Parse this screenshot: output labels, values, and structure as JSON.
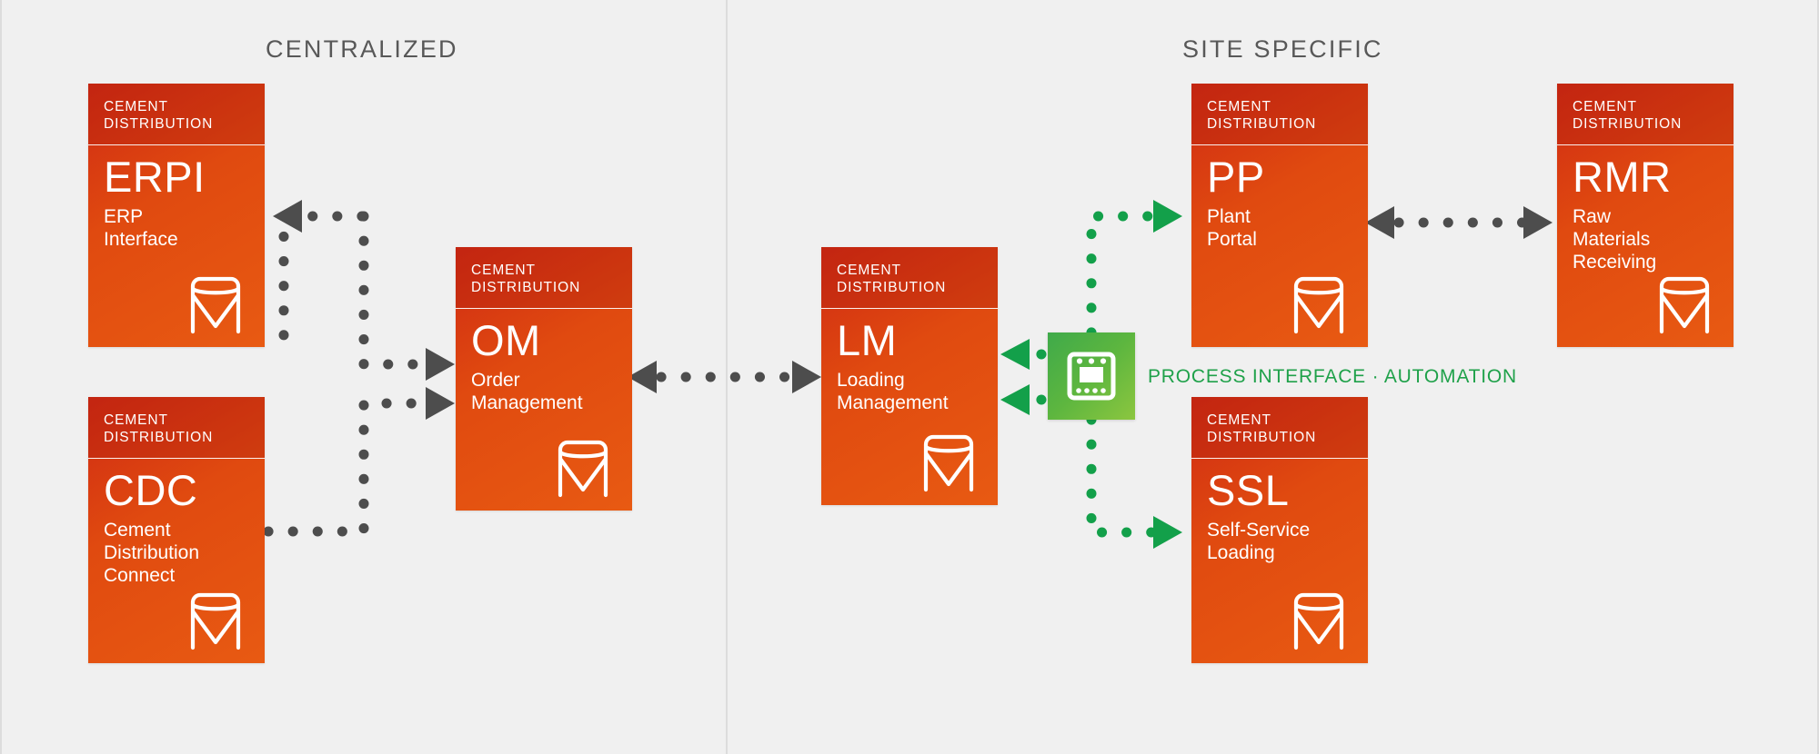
{
  "zones": {
    "left": {
      "title": "CENTRALIZED"
    },
    "right": {
      "title": "SITE SPECIFIC"
    }
  },
  "brand": {
    "head_line1": "CEMENT",
    "head_line2": "DISTRIBUTION",
    "logo_icon": "cement-silo-m-logo"
  },
  "colors": {
    "card_red_dark": "#cf2a13",
    "card_red_light": "#e85a12",
    "green_accent": "#1fa14a",
    "green_box_start": "#3faa4a",
    "green_box_end": "#8cc63f",
    "arrow_grey": "#4d4d4d",
    "background": "#f0f0f0",
    "divider": "#dcdcdc"
  },
  "cards": [
    {
      "id": "erpi",
      "abbr": "ERPI",
      "name": "ERP\nInterface",
      "head_line1": "CEMENT",
      "head_line2": "DISTRIBUTION",
      "zone": "CENTRALIZED"
    },
    {
      "id": "cdc",
      "abbr": "CDC",
      "name": "Cement\nDistribution\nConnect",
      "head_line1": "CEMENT",
      "head_line2": "DISTRIBUTION",
      "zone": "CENTRALIZED"
    },
    {
      "id": "om",
      "abbr": "OM",
      "name": "Order\nManagement",
      "head_line1": "CEMENT",
      "head_line2": "DISTRIBUTION",
      "zone": "CENTRALIZED"
    },
    {
      "id": "lm",
      "abbr": "LM",
      "name": "Loading\nManagement",
      "head_line1": "CEMENT",
      "head_line2": "DISTRIBUTION",
      "zone": "SITE SPECIFIC"
    },
    {
      "id": "pp",
      "abbr": "PP",
      "name": "Plant\nPortal",
      "head_line1": "CEMENT",
      "head_line2": "DISTRIBUTION",
      "zone": "SITE SPECIFIC"
    },
    {
      "id": "rmr",
      "abbr": "RMR",
      "name": "Raw\nMaterials\nReceiving",
      "head_line1": "CEMENT",
      "head_line2": "DISTRIBUTION",
      "zone": "SITE SPECIFIC"
    },
    {
      "id": "ssl",
      "abbr": "SSL",
      "name": "Self-Service\nLoading",
      "head_line1": "CEMENT",
      "head_line2": "DISTRIBUTION",
      "zone": "SITE SPECIFIC"
    }
  ],
  "automation": {
    "label": "PROCESS INTERFACE · AUTOMATION",
    "icon": "microchip-icon"
  },
  "connections": [
    {
      "id": "om-to-erpi",
      "from": "OM",
      "to": "ERPI",
      "style": "dotted",
      "color": "grey",
      "direction": "one-way"
    },
    {
      "id": "erpi-to-om",
      "from": "ERPI",
      "to": "OM",
      "style": "dotted",
      "color": "grey",
      "direction": "one-way"
    },
    {
      "id": "cdc-to-om",
      "from": "CDC",
      "to": "OM",
      "style": "dotted",
      "color": "grey",
      "direction": "one-way"
    },
    {
      "id": "om-lm",
      "from": "OM",
      "to": "LM",
      "style": "dotted",
      "color": "grey",
      "direction": "two-way"
    },
    {
      "id": "automation-to-lm-upper",
      "from": "Process Interface",
      "to": "LM",
      "style": "dotted",
      "color": "green",
      "direction": "one-way"
    },
    {
      "id": "automation-to-lm-lower",
      "from": "Process Interface",
      "to": "LM",
      "style": "dotted",
      "color": "green",
      "direction": "one-way"
    },
    {
      "id": "automation-to-pp",
      "from": "Process Interface",
      "to": "PP",
      "style": "dotted",
      "color": "green",
      "direction": "one-way"
    },
    {
      "id": "automation-to-ssl",
      "from": "Process Interface",
      "to": "SSL",
      "style": "dotted",
      "color": "green",
      "direction": "one-way"
    },
    {
      "id": "pp-rmr",
      "from": "PP",
      "to": "RMR",
      "style": "dotted",
      "color": "grey",
      "direction": "two-way"
    }
  ]
}
